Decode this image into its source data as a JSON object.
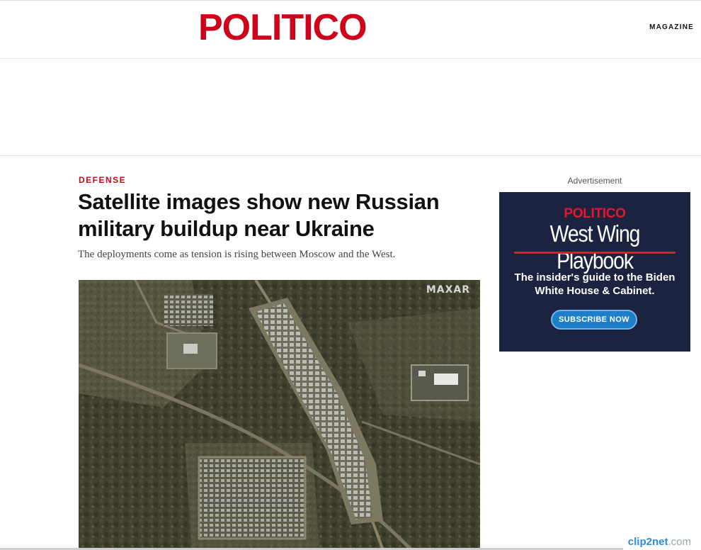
{
  "header": {
    "logo": "POLITICO",
    "nav_magazine": "MAGAZINE"
  },
  "article": {
    "section": "DEFENSE",
    "headline": "Satellite images show new Russian military buildup near Ukraine",
    "dek": "The deployments come as tension is rising between Moscow and the West.",
    "image_watermark": "MAXAR"
  },
  "sidebar": {
    "ad_label": "Advertisement",
    "promo": {
      "brand": "POLITICO",
      "title": "West Wing Playbook",
      "text": "The insider's guide to the Biden White House & Cabinet.",
      "button": "SUBSCRIBE NOW",
      "colors": {
        "background": "#1c2340",
        "accent": "#e8152e",
        "button": "#1e7fc8"
      }
    }
  },
  "footer": {
    "clip_brand": "clip2net",
    "clip_domain": ".com"
  },
  "colors": {
    "brand_red": "#d0021b"
  }
}
